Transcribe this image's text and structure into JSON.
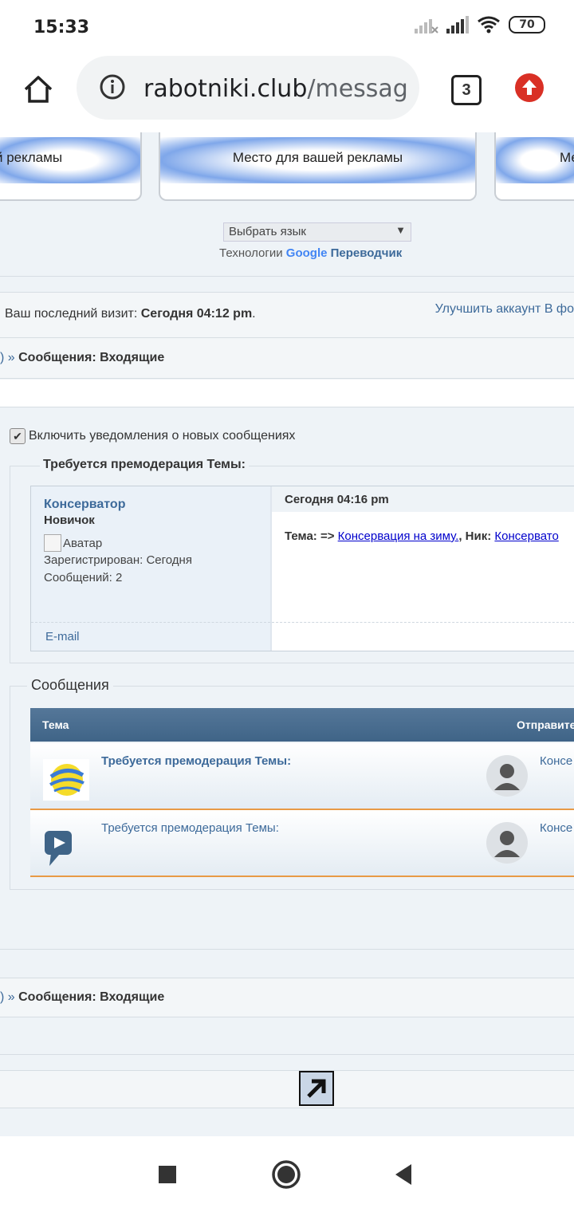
{
  "status": {
    "time": "15:33",
    "battery": "70"
  },
  "browser": {
    "url_host": "rabotniki.club",
    "url_path": "/messages",
    "tab_count": "3"
  },
  "ads": {
    "label_left": "й рекламы",
    "label_center": "Место для вашей рекламы",
    "label_right": "Ме"
  },
  "translate": {
    "select_label": "Выбрать язык",
    "prefix": "Технологии",
    "google": "Google",
    "suffix": "Переводчик"
  },
  "visit": {
    "label": "Ваш последний визит:",
    "value": "Сегодня 04:12 pm",
    "dot": "."
  },
  "header_links": {
    "upgrade": "Улучшить аккаунт",
    "forum": "В фо"
  },
  "breadcrumb": {
    "sep": ") »",
    "current": "Сообщения: Входящие"
  },
  "notify": {
    "label": "Включить уведомления о новых сообщениях"
  },
  "premod": {
    "legend": "Требуется премодерация Темы:",
    "author": "Консерватор",
    "rank": "Новичок",
    "avatar_alt": "Аватар",
    "registered": "Зарегистрирован: Сегодня",
    "posts": "Сообщений: 2",
    "email": "E-mail",
    "date": "Сегодня 04:16 pm",
    "topic_label": "Тема: =>",
    "topic_link": "Консервация на зиму.",
    "nick_label": ", Ник:",
    "nick_link": "Консервато"
  },
  "messages": {
    "legend": "Сообщения",
    "col_subject": "Тема",
    "col_sender": "Отправите",
    "rows": [
      {
        "subject": "Требуется премодерация Темы:",
        "sender": "Консе"
      },
      {
        "subject": "Требуется премодерация Темы:",
        "sender": "Консе"
      }
    ]
  },
  "colors": {
    "accent": "#3d6a9a",
    "table_header": "#4a6e90",
    "row_border": "#e89a46",
    "update_badge": "#d93025"
  }
}
